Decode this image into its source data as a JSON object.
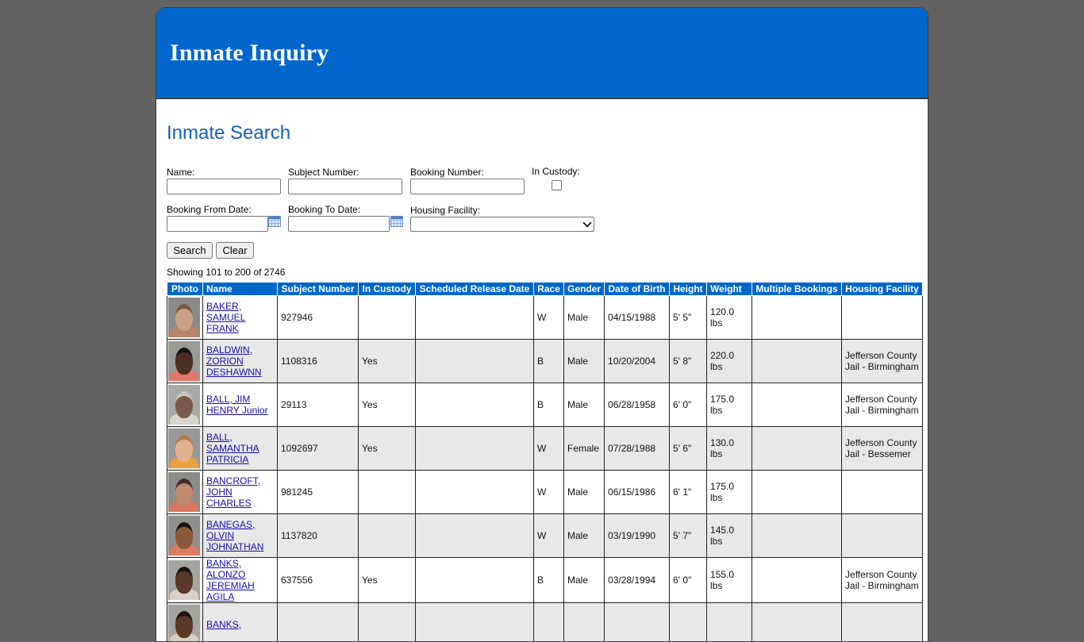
{
  "banner": {
    "title": "Inmate Inquiry"
  },
  "search": {
    "heading": "Inmate Search",
    "name_label": "Name:",
    "subject_label": "Subject Number:",
    "booking_label": "Booking Number:",
    "custody_label": "In Custody:",
    "from_label": "Booking From Date:",
    "to_label": "Booking To Date:",
    "facility_label": "Housing Facility:",
    "search_button": "Search",
    "clear_button": "Clear"
  },
  "results": {
    "summary": "Showing 101 to 200 of 2746",
    "columns": [
      "Photo",
      "Name",
      "Subject Number",
      "In Custody",
      "Scheduled Release Date",
      "Race",
      "Gender",
      "Date of Birth",
      "Height",
      "Weight",
      "Multiple Bookings",
      "Housing Facility"
    ],
    "rows": [
      {
        "name": "BAKER, SAMUEL FRANK",
        "subject": "927946",
        "custody": "",
        "release": "",
        "race": "W",
        "gender": "Male",
        "dob": "04/15/1988",
        "height": "5' 5\"",
        "weight": "120.0 lbs",
        "multiple": "",
        "facility": "",
        "skin": "#c9a184",
        "hair": "#7a5a3c",
        "shirt": "#b8856a",
        "bg": "#8a8a86"
      },
      {
        "name": "BALDWIN, ZORION DESHAWNN",
        "subject": "1108316",
        "custody": "Yes",
        "release": "",
        "race": "B",
        "gender": "Male",
        "dob": "10/20/2004",
        "height": "5' 8\"",
        "weight": "220.0 lbs",
        "multiple": "",
        "facility": "Jefferson County Jail - Birmingham",
        "skin": "#4a2e22",
        "hair": "#1a1210",
        "shirt": "#e0786a",
        "bg": "#9a9a96"
      },
      {
        "name": "BALL, JIM HENRY Junior",
        "subject": "29113",
        "custody": "Yes",
        "release": "",
        "race": "B",
        "gender": "Male",
        "dob": "06/28/1958",
        "height": "6' 0\"",
        "weight": "175.0 lbs",
        "multiple": "",
        "facility": "Jefferson County Jail - Birmingham",
        "skin": "#7a5a48",
        "hair": "#c8c4c0",
        "shirt": "#d8d4cc",
        "bg": "#a8a8a4"
      },
      {
        "name": "BALL, SAMANTHA PATRICIA",
        "subject": "1092697",
        "custody": "Yes",
        "release": "",
        "race": "W",
        "gender": "Female",
        "dob": "07/28/1988",
        "height": "5' 6\"",
        "weight": "130.0 lbs",
        "multiple": "",
        "facility": "Jefferson County Jail - Bessemer",
        "skin": "#e0b090",
        "hair": "#b07a44",
        "shirt": "#e8a040",
        "bg": "#9a9896"
      },
      {
        "name": "BANCROFT, JOHN CHARLES",
        "subject": "981245",
        "custody": "",
        "release": "",
        "race": "W",
        "gender": "Male",
        "dob": "06/15/1986",
        "height": "6' 1\"",
        "weight": "175.0 lbs",
        "multiple": "",
        "facility": "",
        "skin": "#c08a70",
        "hair": "#3a2a20",
        "shirt": "#d87860",
        "bg": "#8c8c88"
      },
      {
        "name": "BANEGAS, OLVIN JOHNATHAN",
        "subject": "1137820",
        "custody": "",
        "release": "",
        "race": "W",
        "gender": "Male",
        "dob": "03/19/1990",
        "height": "5' 7\"",
        "weight": "145.0 lbs",
        "multiple": "",
        "facility": "",
        "skin": "#8a5a3c",
        "hair": "#1a1410",
        "shirt": "#e07a62",
        "bg": "#8e8e8a"
      },
      {
        "name": "BANKS, ALONZO JEREMIAH AGILA",
        "subject": "637556",
        "custody": "Yes",
        "release": "",
        "race": "B",
        "gender": "Male",
        "dob": "03/28/1994",
        "height": "6' 0\"",
        "weight": "155.0 lbs",
        "multiple": "",
        "facility": "Jefferson County Jail - Birmingham",
        "skin": "#5a3a28",
        "hair": "#1c140e",
        "shirt": "#d8d0c4",
        "bg": "#a4a4a0"
      },
      {
        "name": "BANKS,",
        "subject": "",
        "custody": "",
        "release": "",
        "race": "",
        "gender": "",
        "dob": "",
        "height": "",
        "weight": "",
        "multiple": "",
        "facility": "",
        "skin": "#5a3a28",
        "hair": "#1c140e",
        "shirt": "#d8d0c4",
        "bg": "#a4a4a0"
      }
    ]
  }
}
